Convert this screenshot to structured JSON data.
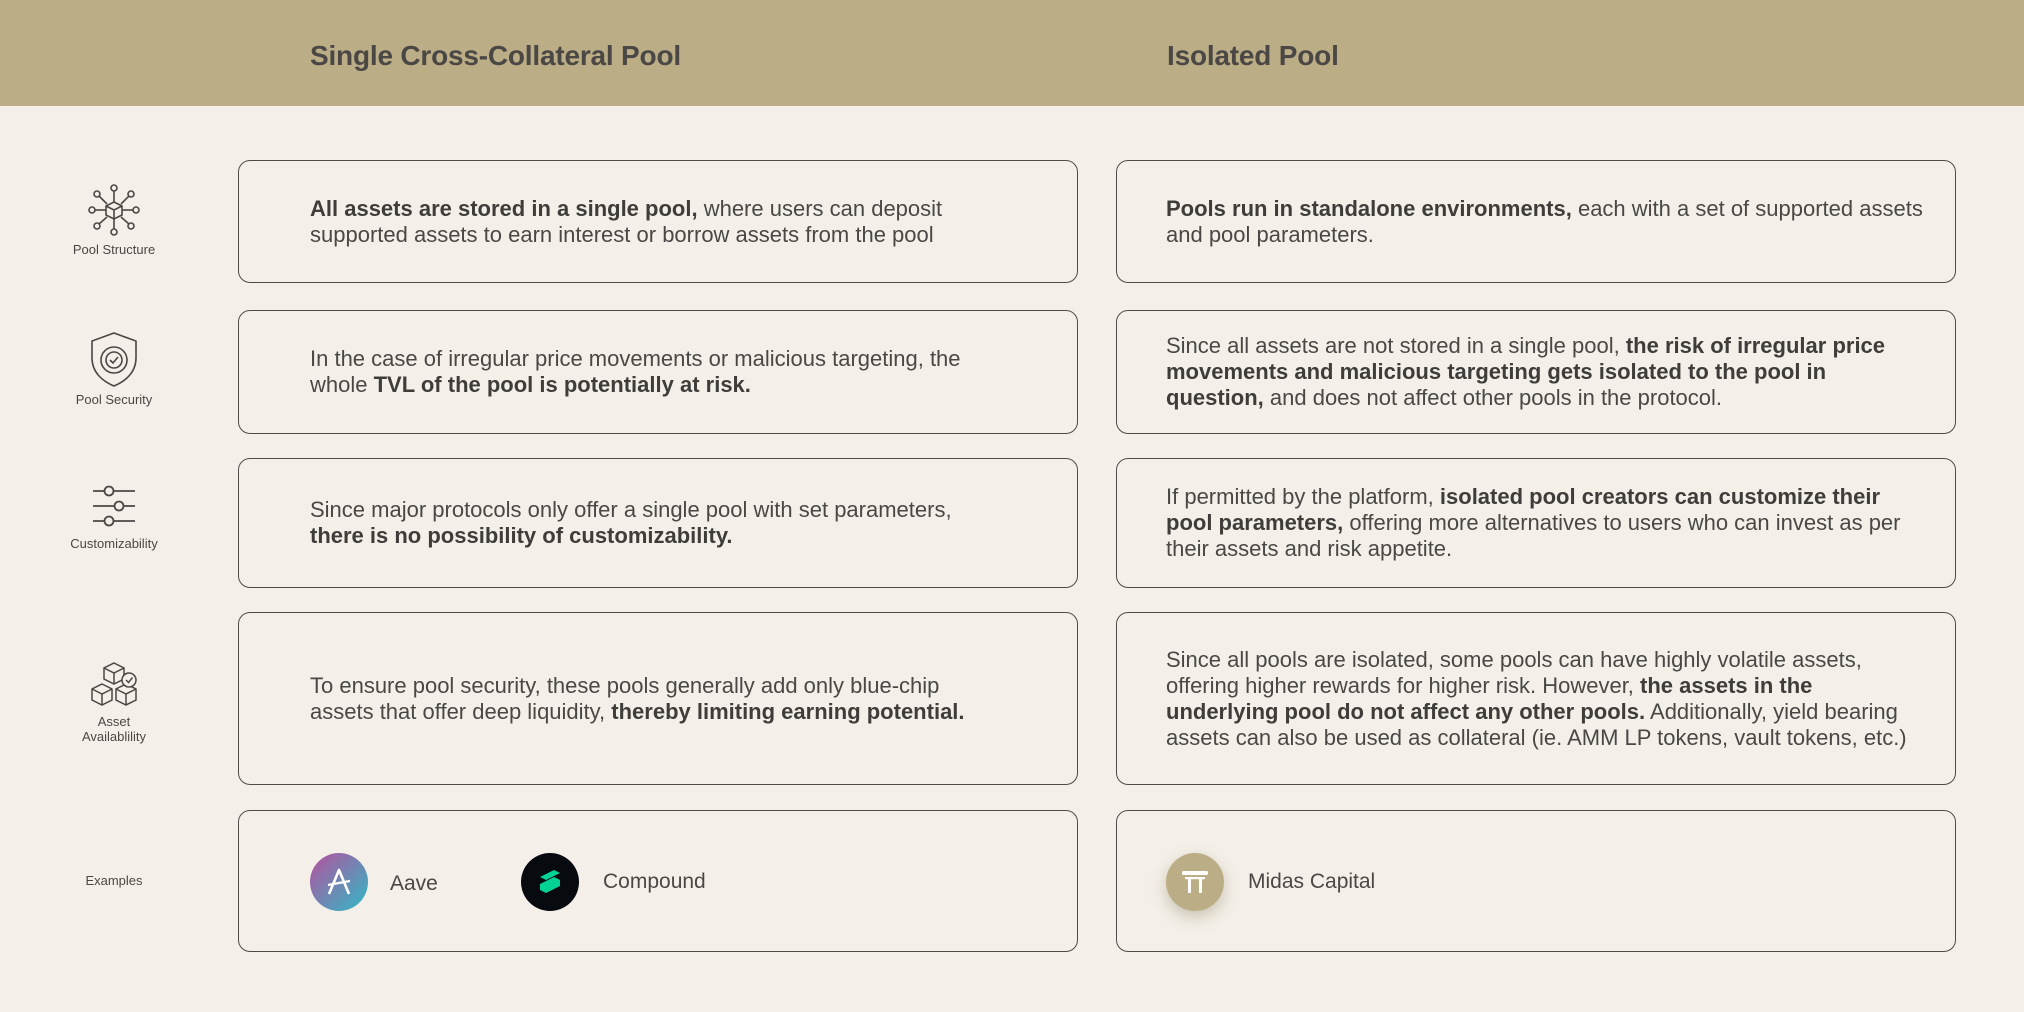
{
  "header": {
    "left_title": "Single Cross-Collateral Pool",
    "right_title": "Isolated Pool"
  },
  "colors": {
    "header_bg": "#bbad85",
    "page_bg": "#f4f0e9",
    "text": "#4a4745",
    "border": "#4f4b48",
    "aave_gradient": [
      "#b6509e",
      "#2ebac6"
    ],
    "compound_bg": "#070a0e",
    "compound_green": "#00d395",
    "midas_bg": "#bbad85"
  },
  "rows": [
    {
      "label": "Pool Structure",
      "icon": "network-cube-icon",
      "left": [
        {
          "t": "All assets are stored in a single pool,",
          "b": true
        },
        {
          "t": " where users can deposit supported assets to earn interest or borrow assets from the pool",
          "b": false
        }
      ],
      "right": [
        {
          "t": "Pools run in standalone environments,",
          "b": true
        },
        {
          "t": " each with a set of supported assets and pool parameters.",
          "b": false
        }
      ]
    },
    {
      "label": "Pool Security",
      "icon": "shield-check-icon",
      "left": [
        {
          "t": "In the case of irregular price movements or malicious targeting, the whole ",
          "b": false
        },
        {
          "t": "TVL of the pool is potentially at risk.",
          "b": true
        }
      ],
      "right": [
        {
          "t": "Since all assets are not stored in a single pool, ",
          "b": false
        },
        {
          "t": "the risk of irregular price movements and malicious targeting gets isolated to the pool in question,",
          "b": true
        },
        {
          "t": " and does not affect other pools in the protocol.",
          "b": false
        }
      ]
    },
    {
      "label": "Customizability",
      "icon": "sliders-icon",
      "left": [
        {
          "t": "Since major protocols only offer a single pool with set parameters, ",
          "b": false
        },
        {
          "t": "there is no possibility of customizability.",
          "b": true
        }
      ],
      "right": [
        {
          "t": "If permitted by the platform, ",
          "b": false
        },
        {
          "t": "isolated pool creators can customize their pool parameters,",
          "b": true
        },
        {
          "t": " offering more alternatives to users who can invest as per their assets and risk appetite.",
          "b": false
        }
      ]
    },
    {
      "label": "Asset Availablility",
      "label_lines": [
        "Asset",
        "Availablility"
      ],
      "icon": "cubes-check-icon",
      "left": [
        {
          "t": "To ensure pool security, these pools generally add only blue-chip assets that offer deep liquidity, ",
          "b": false
        },
        {
          "t": "thereby limiting earning potential.",
          "b": true
        }
      ],
      "right": [
        {
          "t": "Since all pools are isolated, some pools can have highly volatile assets, offering higher rewards for higher risk. However, ",
          "b": false
        },
        {
          "t": "the assets in the underlying pool do not affect any other pools.",
          "b": true
        },
        {
          "t": " Additionally, yield bearing assets can also be used as collateral (ie. AMM LP tokens, vault tokens, etc.)",
          "b": false
        }
      ]
    }
  ],
  "examples": {
    "label": "Examples",
    "left": [
      {
        "name": "Aave",
        "icon": "aave-logo-icon"
      },
      {
        "name": "Compound",
        "icon": "compound-logo-icon"
      }
    ],
    "right": [
      {
        "name": "Midas Capital",
        "icon": "midas-capital-logo-icon"
      }
    ]
  }
}
